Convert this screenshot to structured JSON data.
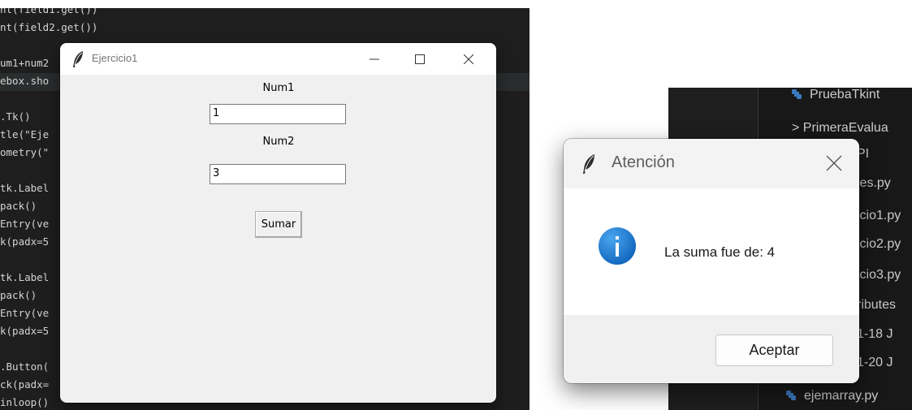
{
  "editor": {
    "lines": [
      "nt(field1.get())",
      "nt(field2.get())",
      "",
      "um1+num2",
      "ebox.sho",
      "",
      ".Tk()",
      "tle(\"Eje",
      "ometry(\"",
      "",
      "tk.Label",
      "pack()",
      "Entry(ve",
      "k(padx=5",
      "",
      "tk.Label",
      "pack()",
      "Entry(ve",
      "k(padx=5",
      "",
      ".Button(",
      "ck(padx=",
      "",
      "inloop()"
    ]
  },
  "main_window": {
    "title": "Ejercicio1",
    "label1": "Num1",
    "entry1_value": "1",
    "label2": "Num2",
    "entry2_value": "3",
    "button_label": "Sumar"
  },
  "explorer": {
    "items": [
      {
        "label": "PruebaTkint",
        "icon": "python-icon"
      },
      {
        "label": "> PrimeraEvalua",
        "icon": ""
      },
      {
        "label": "PI",
        "icon": ""
      },
      {
        "label": "ies.py",
        "icon": ""
      },
      {
        "label": "icio1.py",
        "icon": ""
      },
      {
        "label": "icio2.py",
        "icon": ""
      },
      {
        "label": "icio3.py",
        "icon": ""
      },
      {
        "label": "ributes",
        "icon": ""
      },
      {
        "label": "1-18 J",
        "icon": ""
      },
      {
        "label": "1-20 J",
        "icon": ""
      },
      {
        "label": "ejemarray.py",
        "icon": "python-icon"
      }
    ]
  },
  "dialog": {
    "title": "Atención",
    "message": "La suma fue de: 4",
    "ok_label": "Aceptar",
    "icon": "info-icon",
    "accent": "#1a78d0"
  }
}
